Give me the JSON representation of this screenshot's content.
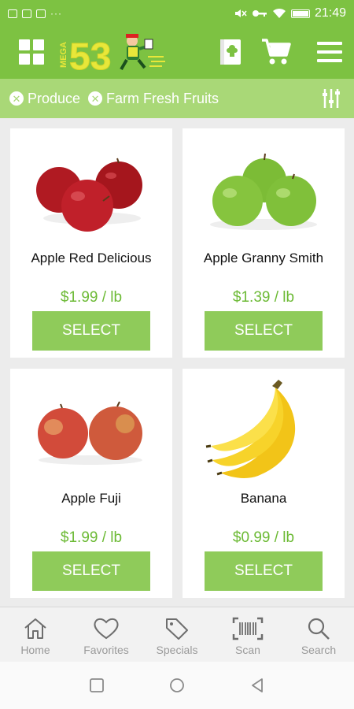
{
  "status_bar": {
    "time": "21:49",
    "dots": "···"
  },
  "header": {
    "logo_small": "MEGA",
    "logo_number": "53"
  },
  "filters": {
    "chips": [
      {
        "label": "Produce"
      },
      {
        "label": "Farm Fresh Fruits"
      }
    ]
  },
  "products": [
    {
      "name": "Apple Red Delicious",
      "price": "$1.99 / lb",
      "button": "SELECT",
      "image": "red-apples"
    },
    {
      "name": "Apple Granny Smith",
      "price": "$1.39 / lb",
      "button": "SELECT",
      "image": "green-apples"
    },
    {
      "name": "Apple Fuji",
      "price": "$1.99 / lb",
      "button": "SELECT",
      "image": "fuji-apples"
    },
    {
      "name": "Banana",
      "price": "$0.99 / lb",
      "button": "SELECT",
      "image": "bananas"
    }
  ],
  "bottom_nav": [
    {
      "label": "Home",
      "icon": "home-icon"
    },
    {
      "label": "Favorites",
      "icon": "heart-icon"
    },
    {
      "label": "Specials",
      "icon": "tag-icon"
    },
    {
      "label": "Scan",
      "icon": "barcode-icon"
    },
    {
      "label": "Search",
      "icon": "search-icon"
    }
  ],
  "colors": {
    "brand_green": "#7dc242",
    "filter_green": "#a9d877",
    "button_green": "#8fcb5a",
    "price_green": "#6cba35",
    "logo_yellow": "#e8e73a"
  }
}
